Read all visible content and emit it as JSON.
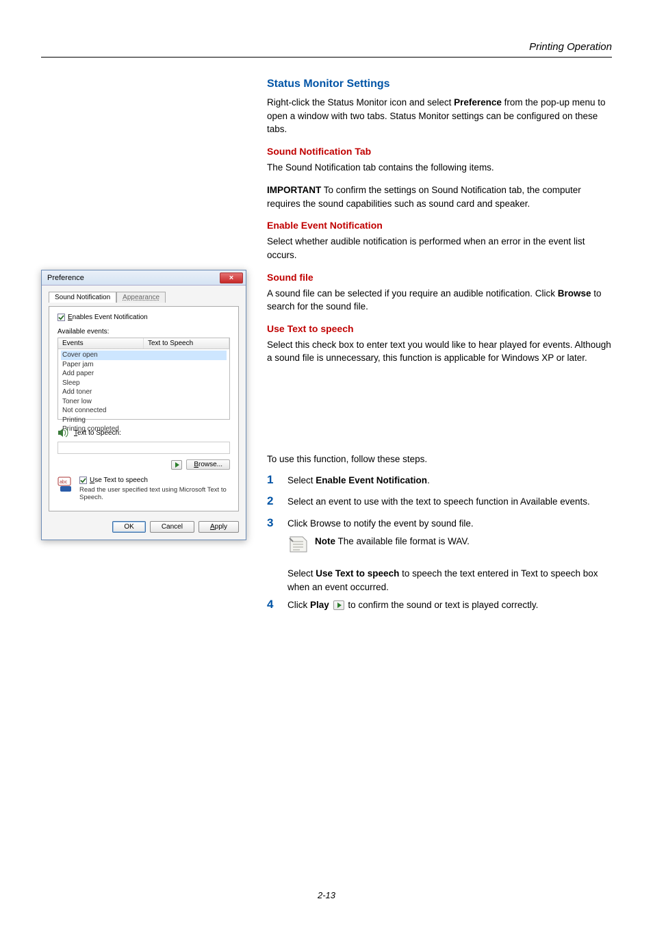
{
  "header": {
    "section": "Printing Operation"
  },
  "headings": {
    "h1": "Status Monitor Settings",
    "h2": "Sound Notification Tab",
    "h3": "Enable Event Notification",
    "h4": "Sound file",
    "h5": "Use Text to speech"
  },
  "paragraphs": {
    "intro1a": "Right-click the Status Monitor icon and select ",
    "intro1b": "Preference",
    "intro1c": " from the pop-up menu to open a window with two tabs. Status Monitor settings can be configured on these tabs.",
    "sound_tab": "The Sound Notification tab contains the following items.",
    "important_label": "IMPORTANT",
    "important_body": "  To confirm the settings on Sound Notification tab, the computer requires the sound capabilities such as sound card and speaker.",
    "enable_body": "Select whether audible notification is performed when an error in the event list occurs.",
    "soundfile_a": "A sound file can be selected if you require an audible notification. Click ",
    "soundfile_b": "Browse",
    "soundfile_c": " to search for the sound file.",
    "tts_body": "Select this check box to enter text you would like to hear played for events. Although a sound file is unnecessary, this function is applicable for Windows XP or later."
  },
  "steps": {
    "intro": "To use this function, follow these steps.",
    "n1": "1",
    "s1a": "Select ",
    "s1b": "Enable Event Notification",
    "s1c": ".",
    "n2": "2",
    "s2": "Select an event to use with the text to speech function in Available events.",
    "n3": "3",
    "s3": "Click Browse to notify the event by sound file.",
    "note_label": "Note",
    "note_body": "  The available file format is WAV.",
    "s3_extra_a": "Select ",
    "s3_extra_b": "Use Text to speech",
    "s3_extra_c": " to speech the text entered in Text to speech box when an event occurred.",
    "n4": "4",
    "s4a": "Click ",
    "s4b": "Play",
    "s4c": " to confirm the sound or text is played correctly."
  },
  "dialog": {
    "title": "Preference",
    "tab_active": "Sound Notification",
    "tab_inactive": "Appearance",
    "chk_enable": "Enables Event Notification",
    "available_label": "Available events:",
    "col1": "Events",
    "col2": "Text to Speech",
    "events": {
      "e0": "Cover open",
      "e1": "Paper jam",
      "e2": "Add paper",
      "e3": "Sleep",
      "e4": "Add toner",
      "e5": "Toner low",
      "e6": "Not connected",
      "e7": "Printing",
      "e8": "Printing completed"
    },
    "tts_label": "Text to Speech:",
    "browse": "Browse...",
    "use_tts": "Use Text to speech",
    "read_text": "Read the user specified text using Microsoft Text to Speech.",
    "ok": "OK",
    "cancel": "Cancel",
    "apply": "Apply",
    "apply_u": "A",
    "close_x": "×"
  },
  "footer": {
    "page": "2-13"
  }
}
